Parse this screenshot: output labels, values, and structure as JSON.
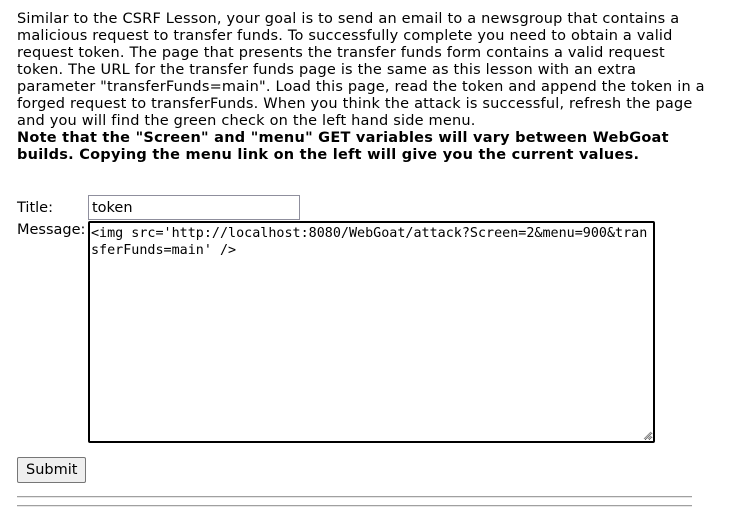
{
  "instructions": {
    "paragraph": "Similar to the CSRF Lesson, your goal is to send an email to a newsgroup that contains a malicious request to transfer funds. To successfully complete you need to obtain a valid request token. The page that presents the transfer funds form contains a valid request token. The URL for the transfer funds page is the same as this lesson with an extra parameter \"transferFunds=main\". Load this page, read the token and append the token in a forged request to transferFunds. When you think the attack is successful, refresh the page and you will find the green check on the left hand side menu.",
    "note": "Note that the \"Screen\" and \"menu\" GET variables will vary between WebGoat builds. Copying the menu link on the left will give you the current values."
  },
  "form": {
    "title_label": "Title:",
    "title_value": "token",
    "message_label": "Message:",
    "message_value": "<img src='http://localhost:8080/WebGoat/attack?Screen=2&menu=900&transferFunds=main' />",
    "submit_label": "Submit"
  }
}
